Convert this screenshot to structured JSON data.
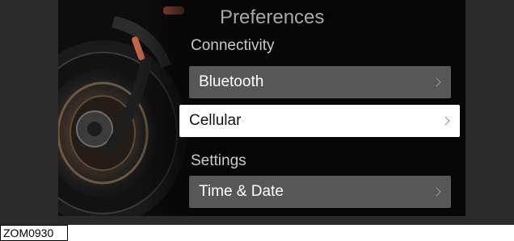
{
  "screen": {
    "title": "Preferences",
    "sections": [
      {
        "label": "Connectivity"
      },
      {
        "label": "Settings"
      }
    ],
    "items": [
      {
        "label": "Bluetooth"
      },
      {
        "label": "Cellular"
      },
      {
        "label": "Time & Date"
      }
    ],
    "selected_item": "Cellular"
  },
  "caption": {
    "code": "ZOM0930"
  },
  "colors": {
    "background": "#050505",
    "item_bg": "#575757",
    "selected_bg": "#ffffff",
    "title_text": "#a8a8a8"
  },
  "icons": {
    "item_arrow": "chevron-right-icon",
    "background_image": "motorcycle-rear-wheel"
  }
}
